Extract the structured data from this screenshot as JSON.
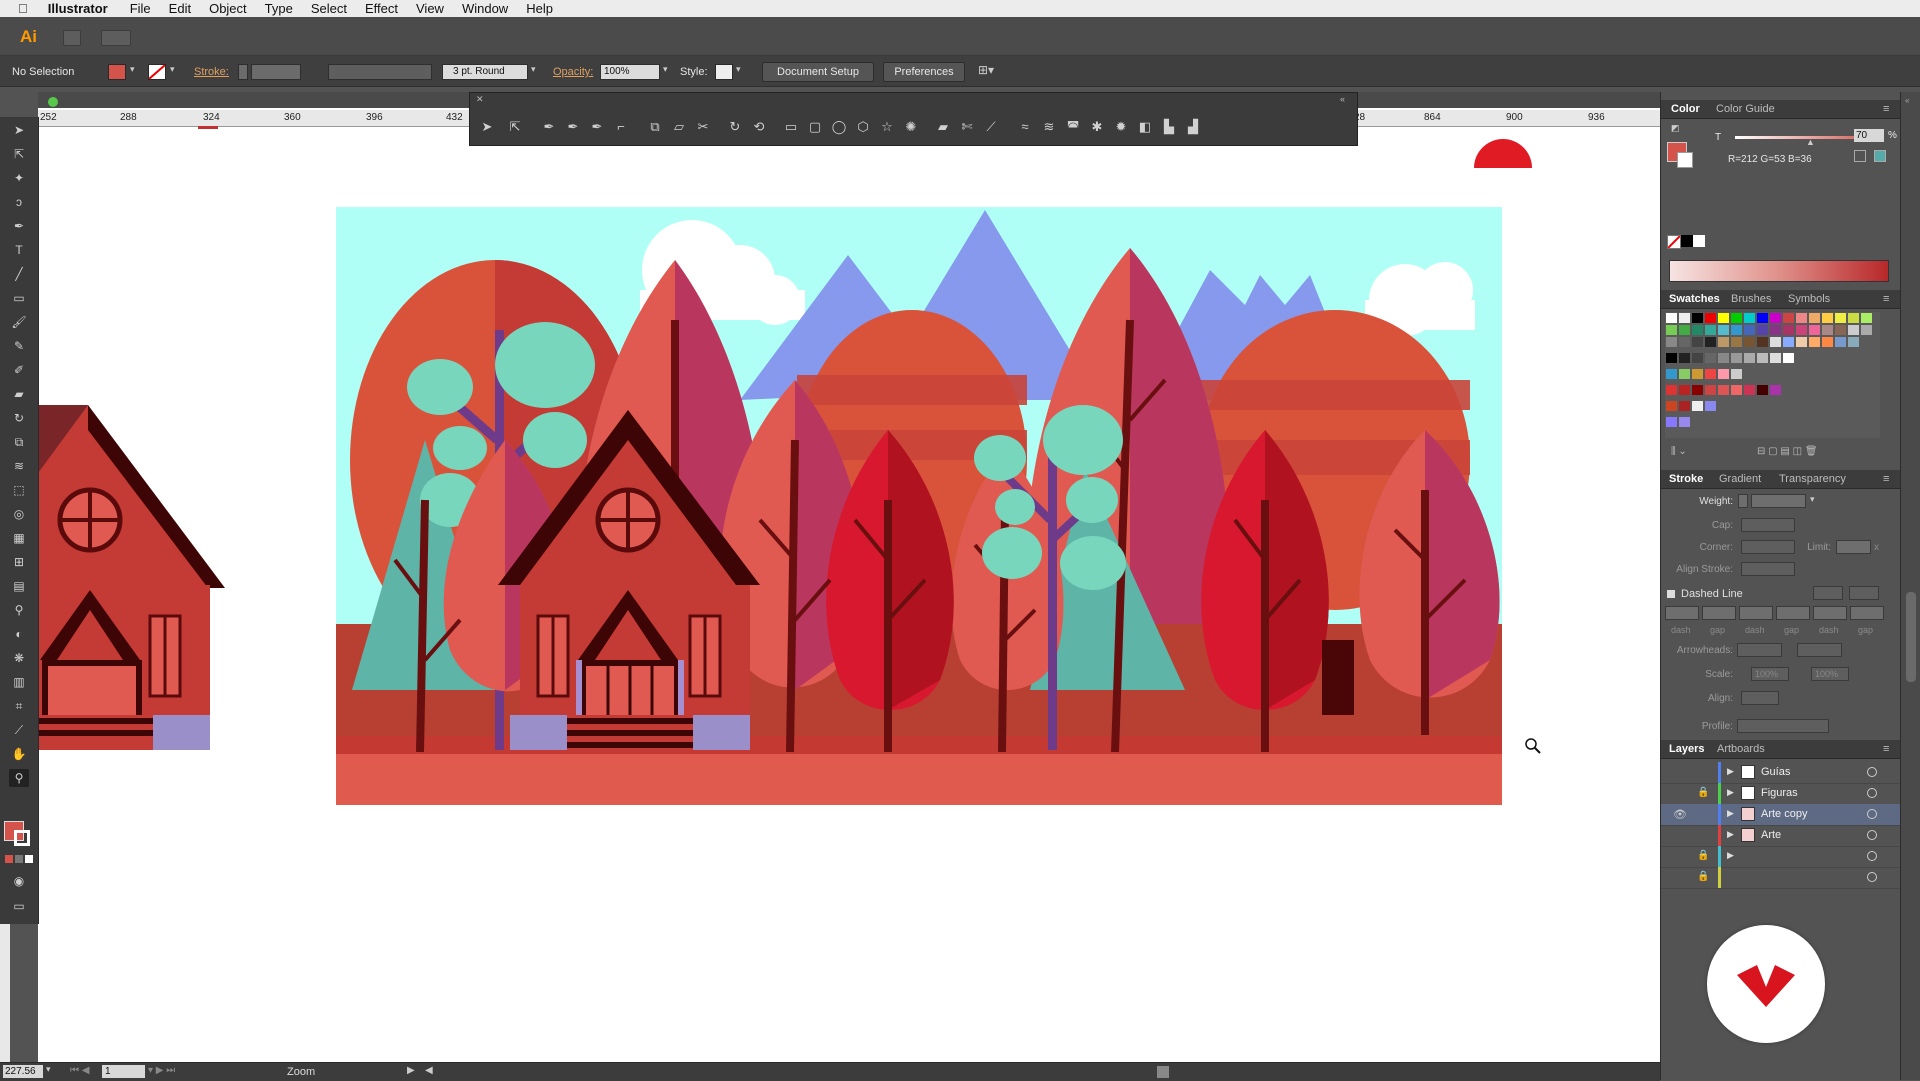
{
  "menubar": {
    "app_name": "Illustrator",
    "items": [
      "File",
      "Edit",
      "Object",
      "Type",
      "Select",
      "Effect",
      "View",
      "Window",
      "Help"
    ]
  },
  "appbar": {
    "logo": "Ai"
  },
  "control_bar": {
    "selection_status": "No Selection",
    "stroke_label": "Stroke:",
    "brush_value": "3 pt. Round",
    "opacity_label": "Opacity:",
    "opacity_value": "100%",
    "style_label": "Style:",
    "document_setup": "Document Setup",
    "preferences": "Preferences"
  },
  "ruler": {
    "ticks": [
      "252",
      "288",
      "324",
      "360",
      "396",
      "432",
      "28",
      "864",
      "900",
      "936"
    ]
  },
  "status_bar": {
    "zoom_value": "227.56",
    "artboard_number": "1",
    "tool_name": "Zoom"
  },
  "color_panel": {
    "tabs": [
      "Color",
      "Color Guide"
    ],
    "channel": "T",
    "tint_value": "70",
    "percent": "%",
    "rgb_readout": "R=212 G=53 B=36"
  },
  "swatches_panel": {
    "tabs": [
      "Swatches",
      "Brushes",
      "Symbols"
    ]
  },
  "stroke_panel": {
    "tabs": [
      "Stroke",
      "Gradient",
      "Transparency"
    ],
    "weight_label": "Weight:",
    "cap_label": "Cap:",
    "corner_label": "Corner:",
    "limit_label": "Limit:",
    "limit_x": "x",
    "align_label": "Align Stroke:",
    "dashed_label": "Dashed Line",
    "dash_labels": [
      "dash",
      "gap",
      "dash",
      "gap",
      "dash",
      "gap"
    ],
    "arrowheads_label": "Arrowheads:",
    "scale_label": "Scale:",
    "scale_1": "100%",
    "scale_2": "100%",
    "align2_label": "Align:",
    "profile_label": "Profile:"
  },
  "layers_panel": {
    "tabs": [
      "Layers",
      "Artboards"
    ],
    "layers": [
      {
        "name": "Guías",
        "color": "#4f7ff0"
      },
      {
        "name": "Figuras",
        "color": "#4bd04b"
      },
      {
        "name": "Arte copy",
        "color": "#4f7ff0"
      },
      {
        "name": "Arte",
        "color": "#e04040"
      },
      {
        "name": "",
        "color": "#40c0d0"
      },
      {
        "name": "",
        "color": "#d0d040"
      }
    ]
  },
  "colors": {
    "sky": "#b0fff6",
    "ground": "#e05a4e",
    "mountain": "#8699ec",
    "accent": "#ff9a00"
  },
  "tools_icons": [
    "selection-icon",
    "direct-selection-icon",
    "magic-wand-icon",
    "lasso-icon",
    "pen-icon",
    "type-icon",
    "line-icon",
    "rectangle-icon",
    "paintbrush-icon",
    "pencil-icon",
    "blob-brush-icon",
    "eraser-icon",
    "rotate-icon",
    "scale-icon",
    "warp-icon",
    "free-transform-icon",
    "shape-builder-icon",
    "perspective-icon",
    "mesh-icon",
    "gradient-icon",
    "eyedropper-icon",
    "blend-icon",
    "symbol-sprayer-icon",
    "graph-icon",
    "artboard-icon",
    "slice-icon",
    "hand-icon",
    "zoom-icon"
  ]
}
